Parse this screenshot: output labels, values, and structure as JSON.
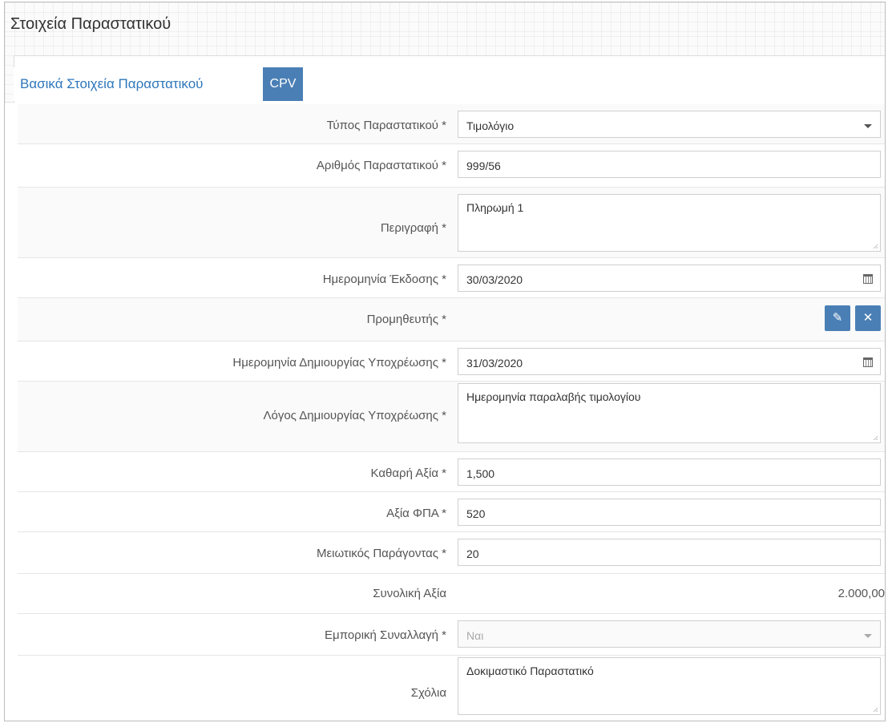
{
  "panel": {
    "title": "Στοιχεία Παραστατικού"
  },
  "tabs": [
    {
      "label": "Βασικά Στοιχεία Παραστατικού",
      "active": true
    },
    {
      "label": "CPV",
      "active": false
    }
  ],
  "form": {
    "doc_type": {
      "label": "Τύπος Παραστατικού *",
      "value": "Τιμολόγιο"
    },
    "doc_number": {
      "label": "Αριθμός Παραστατικού *",
      "value": "999/56"
    },
    "description": {
      "label": "Περιγραφή *",
      "value": "Πληρωμή 1"
    },
    "issue_date": {
      "label": "Ημερομηνία Έκδοσης *",
      "value": "30/03/2020"
    },
    "supplier": {
      "label": "Προμηθευτής *"
    },
    "obligation_date": {
      "label": "Ημερομηνία Δημιουργίας Υποχρέωσης *",
      "value": "31/03/2020"
    },
    "obligation_reason": {
      "label": "Λόγος Δημιουργίας Υποχρέωσης *",
      "value": "Ημερομηνία παραλαβής τιμολογίου"
    },
    "net_value": {
      "label": "Καθαρή Αξία *",
      "value": "1,500"
    },
    "vat_value": {
      "label": "Αξία ΦΠΑ *",
      "value": "520"
    },
    "reduction_factor": {
      "label": "Μειωτικός Παράγοντας *",
      "value": "20"
    },
    "total_value": {
      "label": "Συνολική Αξία",
      "value": "2.000,00"
    },
    "commercial_tx": {
      "label": "Εμπορική Συναλλαγή *",
      "value": "Ναι"
    },
    "comments": {
      "label": "Σχόλια",
      "value": "Δοκιμαστικό Παραστατικό"
    }
  },
  "colors": {
    "accent": "#4a7fb5",
    "tab_text": "#2e77bb"
  }
}
